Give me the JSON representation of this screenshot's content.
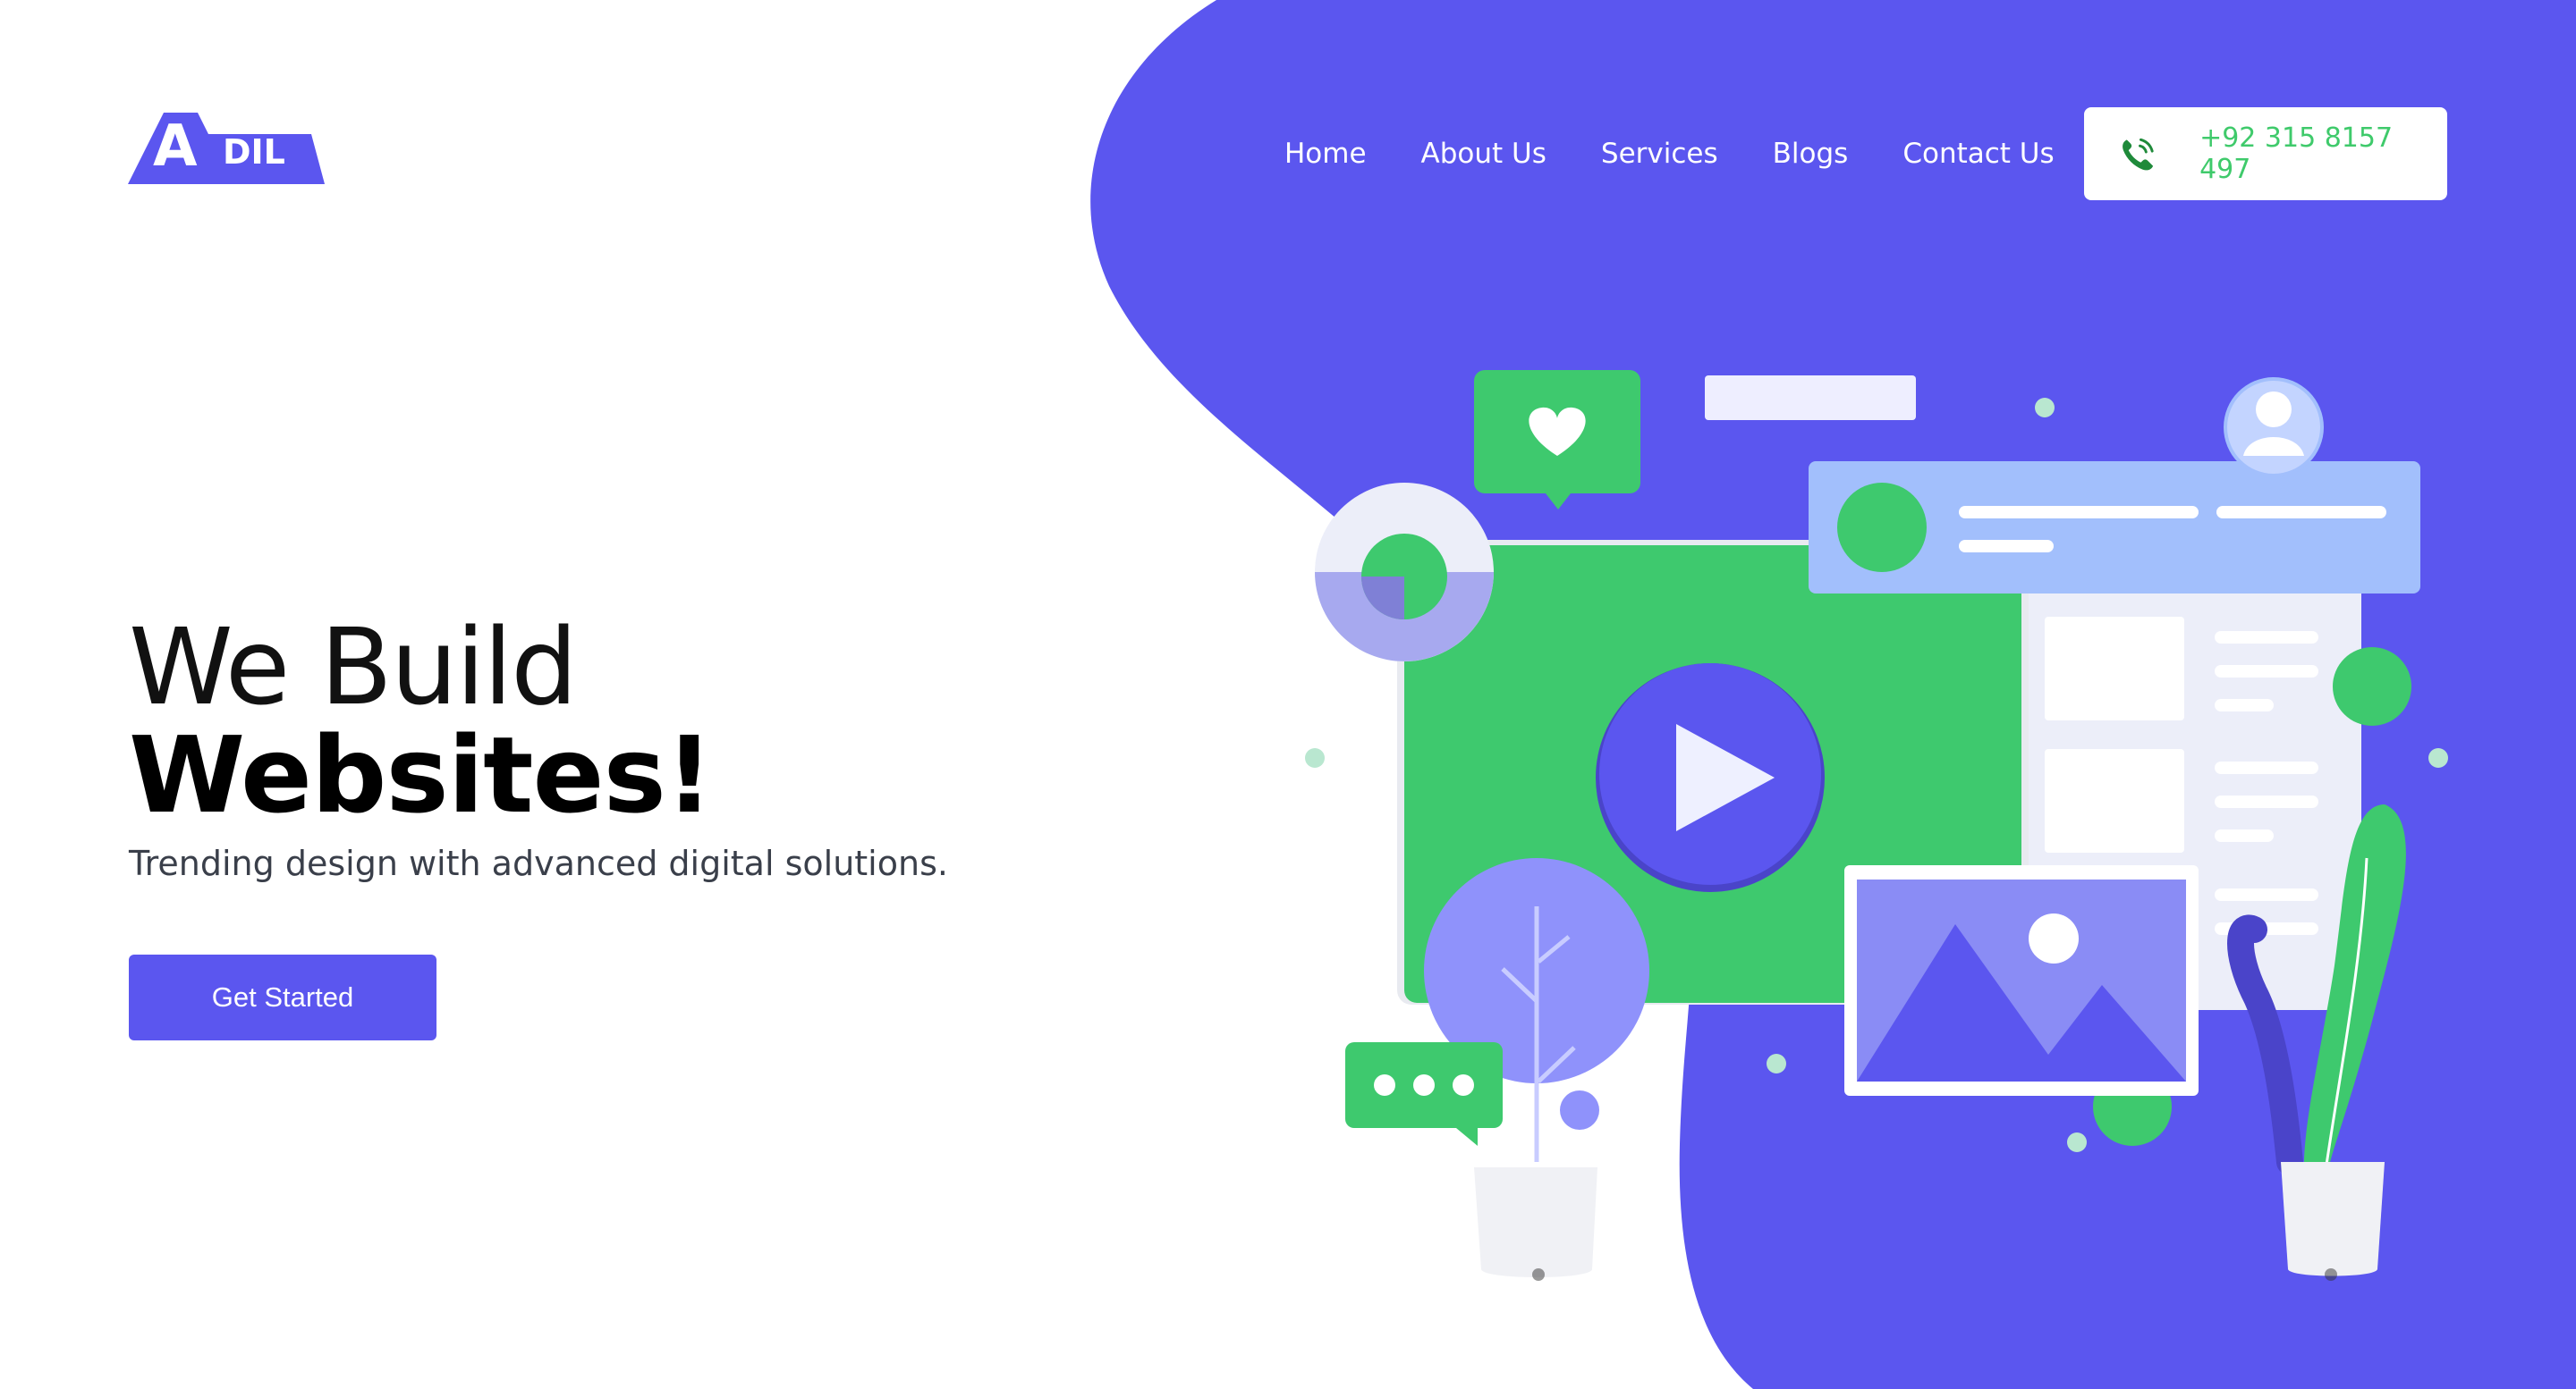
{
  "brand": {
    "logo_big": "A",
    "logo_small": "DIL",
    "accent_color": "#5b56ef",
    "green_color": "#3ec96e"
  },
  "nav": {
    "items": [
      {
        "label": "Home"
      },
      {
        "label": "About Us"
      },
      {
        "label": "Services"
      },
      {
        "label": "Blogs"
      },
      {
        "label": "Contact Us"
      }
    ]
  },
  "contact": {
    "phone": "+92 315 8157 497",
    "icon": "phone-icon"
  },
  "hero": {
    "line1": "We Build",
    "line2": "Websites!",
    "subtitle": "Trending design with advanced digital solutions.",
    "cta_label": "Get Started"
  },
  "illustration": {
    "icons": [
      "heart-icon",
      "play-icon",
      "user-avatar-icon",
      "chat-dots-icon",
      "image-icon",
      "donut-chart-icon",
      "plant-icon",
      "tree-icon"
    ]
  }
}
